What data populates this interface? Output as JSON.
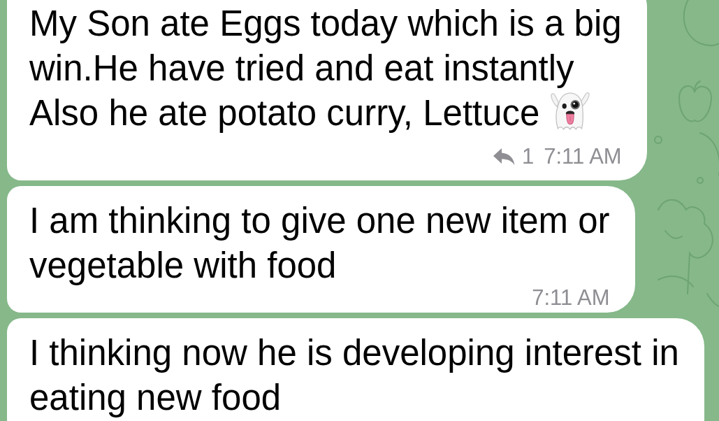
{
  "messages": [
    {
      "lines": [
        "My Son ate Eggs today which is a big",
        "win.He have tried and eat instantly",
        "Also he ate potato curry, Lettuce"
      ],
      "emoji": true,
      "reply_count": "1",
      "time": "7:11 AM"
    },
    {
      "lines": [
        "I am thinking to give one new item or",
        "vegetable with food"
      ],
      "time": "7:11 AM"
    },
    {
      "lines": [
        "I thinking now he is developing interest in",
        "eating new food"
      ]
    }
  ]
}
